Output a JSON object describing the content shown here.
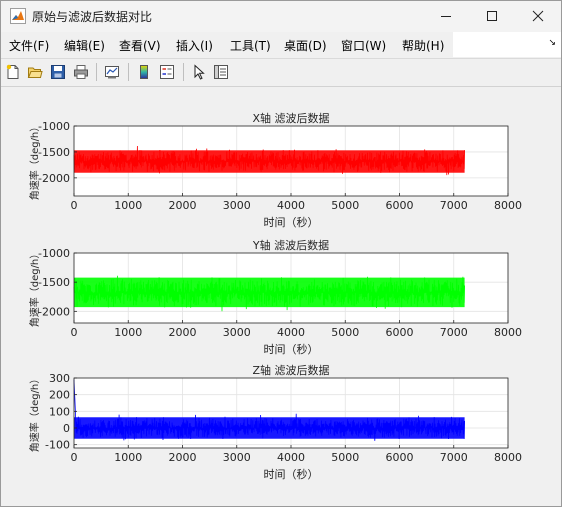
{
  "window": {
    "title": "原始与滤波后数据对比",
    "controls": {
      "minimize": "minimize-icon",
      "maximize": "maximize-icon",
      "close": "close-icon"
    }
  },
  "menubar": {
    "items": [
      {
        "label": "文件(F)"
      },
      {
        "label": "编辑(E)"
      },
      {
        "label": "查看(V)"
      },
      {
        "label": "插入(I)"
      },
      {
        "label": "工具(T)"
      },
      {
        "label": "桌面(D)"
      },
      {
        "label": "窗口(W)"
      },
      {
        "label": "帮助(H)"
      }
    ],
    "overflow_icon": "dock-arrow-icon"
  },
  "toolbar": {
    "icons": [
      "new-figure-icon",
      "open-file-icon",
      "save-icon",
      "print-icon",
      "link-plot-icon",
      "colorbar-icon",
      "legend-icon",
      "edit-plot-icon",
      "property-inspector-icon"
    ]
  },
  "colors": {
    "x_series": "#ff0000",
    "y_series": "#00ff00",
    "z_series": "#0000ff"
  },
  "chart_data": [
    {
      "type": "line",
      "title": "X轴 滤波后数据",
      "xlabel": "时间（秒）",
      "ylabel": "角速率（deg/h）",
      "xlim": [
        0,
        8000
      ],
      "ylim": [
        -2350,
        -1000
      ],
      "xticks": [
        0,
        1000,
        2000,
        3000,
        4000,
        5000,
        6000,
        7000,
        8000
      ],
      "yticks": [
        -1000,
        -1500,
        -2000
      ],
      "grid": true,
      "series": [
        {
          "x_range": [
            0,
            7200
          ],
          "mean": -1680,
          "band": [
            -1450,
            -1920
          ],
          "color": "#ff0000"
        }
      ]
    },
    {
      "type": "line",
      "title": "Y轴 滤波后数据",
      "xlabel": "时间（秒）",
      "ylabel": "角速率（deg/h）",
      "xlim": [
        0,
        8000
      ],
      "ylim": [
        -2200,
        -1000
      ],
      "xticks": [
        0,
        1000,
        2000,
        3000,
        4000,
        5000,
        6000,
        7000,
        8000
      ],
      "yticks": [
        -1000,
        -1500,
        -2000
      ],
      "grid": true,
      "series": [
        {
          "x_range": [
            0,
            7200
          ],
          "mean": -1680,
          "band": [
            -1400,
            -1950
          ],
          "color": "#00ff00"
        }
      ]
    },
    {
      "type": "line",
      "title": "Z轴 滤波后数据",
      "xlabel": "时间（秒）",
      "ylabel": "角速率（deg/h）",
      "xlim": [
        0,
        8000
      ],
      "ylim": [
        -120,
        300
      ],
      "xticks": [
        0,
        1000,
        2000,
        3000,
        4000,
        5000,
        6000,
        7000,
        8000
      ],
      "yticks": [
        300,
        200,
        100,
        0,
        -100
      ],
      "grid": true,
      "series": [
        {
          "x_range": [
            0,
            7200
          ],
          "mean": 0,
          "band": [
            70,
            -70
          ],
          "initial_spike": 290,
          "color": "#0000ff"
        }
      ]
    }
  ]
}
